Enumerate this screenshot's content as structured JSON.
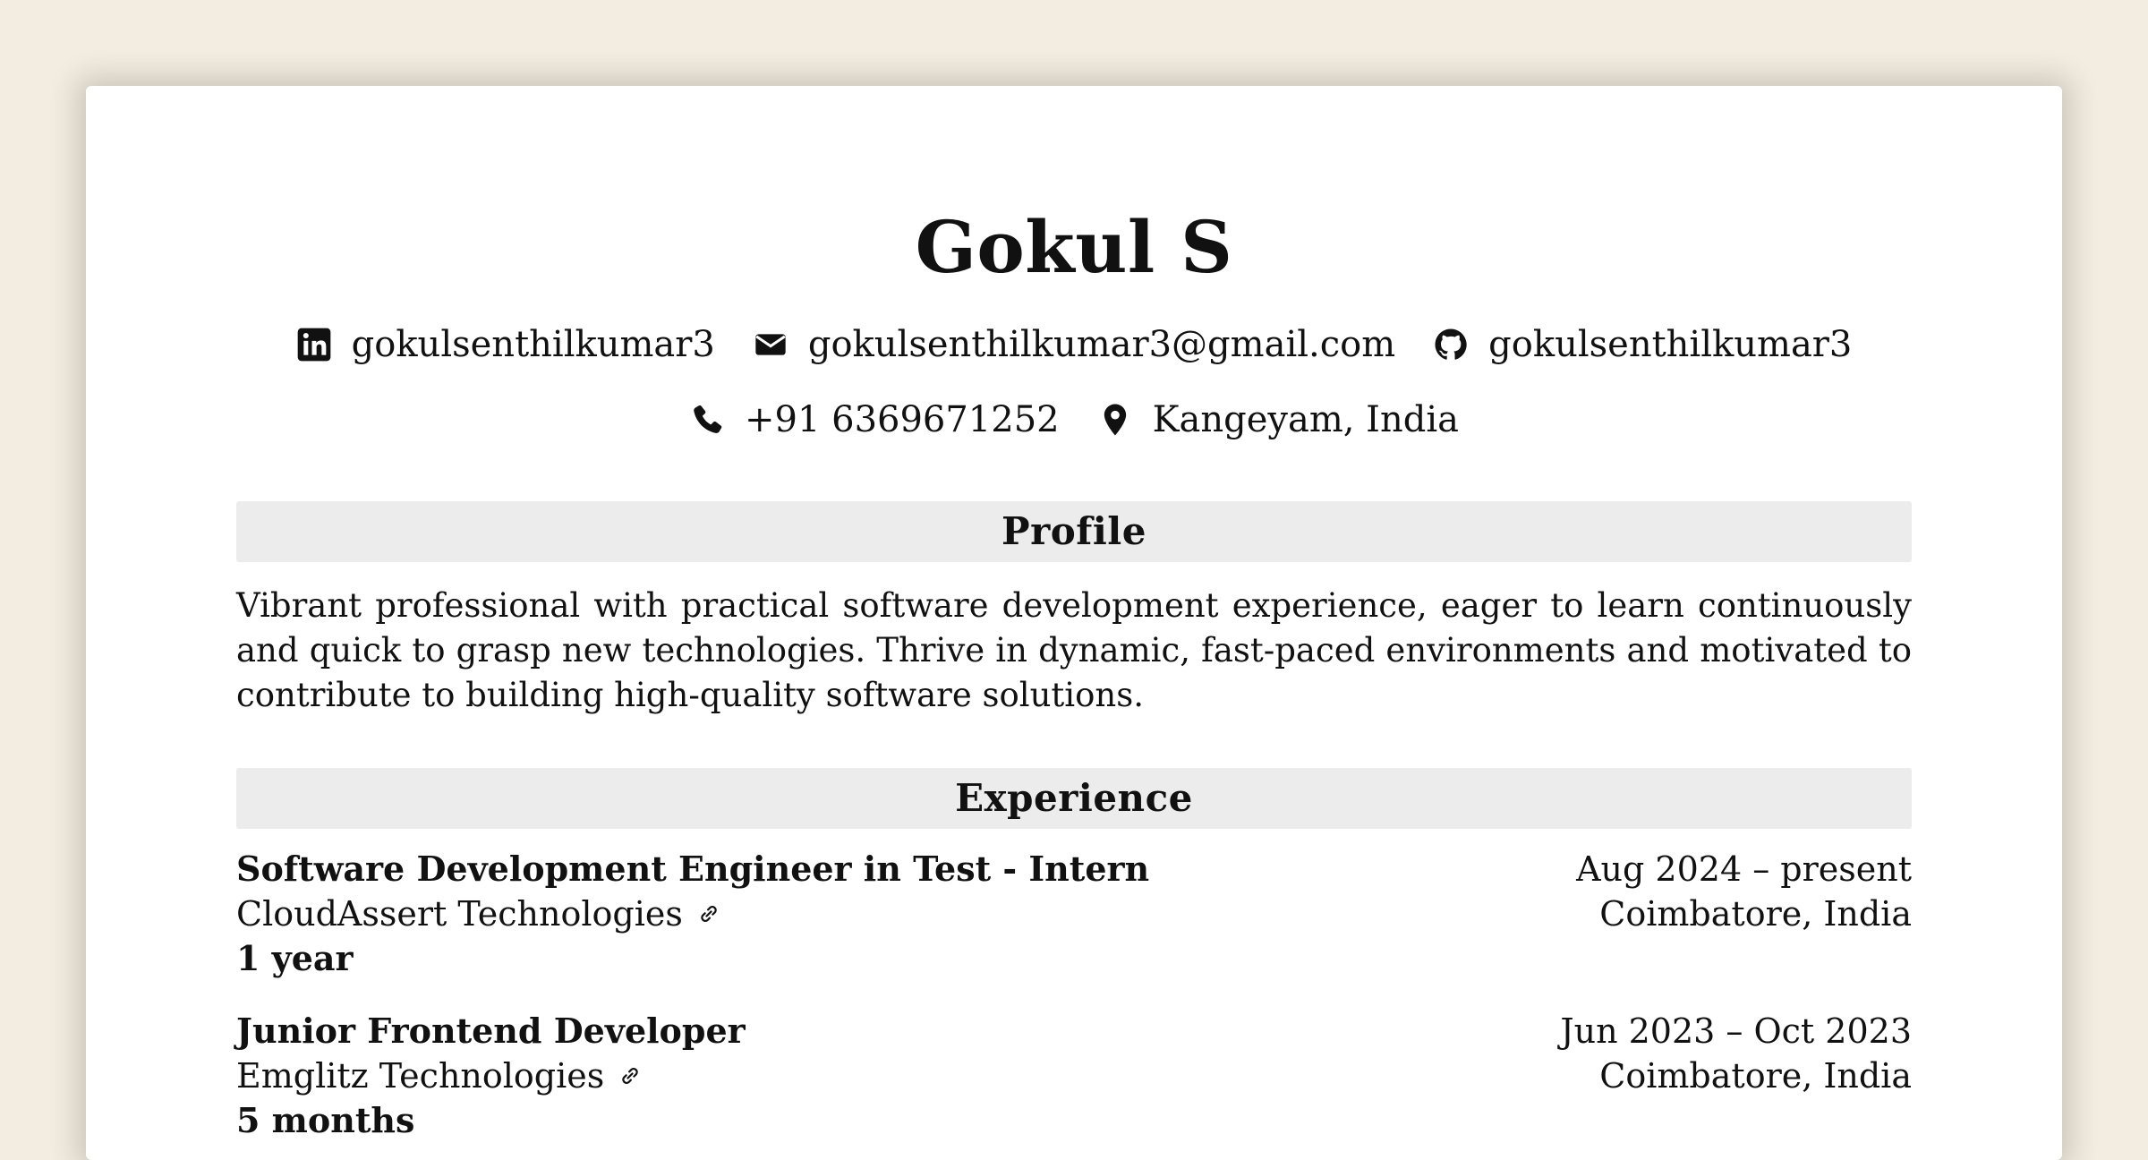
{
  "header": {
    "name": "Gokul S",
    "contacts_row1": [
      {
        "icon": "linkedin-icon",
        "text": "gokulsenthilkumar3"
      },
      {
        "icon": "mail-icon",
        "text": "gokulsenthilkumar3@gmail.com"
      },
      {
        "icon": "github-icon",
        "text": "gokulsenthilkumar3"
      }
    ],
    "contacts_row2": [
      {
        "icon": "phone-icon",
        "text": "+91 6369671252"
      },
      {
        "icon": "location-pin-icon",
        "text": "Kangeyam, India"
      }
    ]
  },
  "profile": {
    "heading": "Profile",
    "text": "Vibrant professional with practical software development experience, eager to learn continuously and quick to grasp new technologies. Thrive in dynamic, fast-paced environments and motivated to contribute to building high-quality software solutions."
  },
  "experience": {
    "heading": "Experience",
    "jobs": [
      {
        "title": "Software Development Engineer in Test - Intern",
        "dates": "Aug 2024 – present",
        "company": "CloudAssert Technologies",
        "location": "Coimbatore, India",
        "duration": "1 year",
        "link_icon": "link-icon"
      },
      {
        "title": "Junior Frontend Developer",
        "dates": "Jun 2023 – Oct 2023",
        "company": "Emglitz Technologies",
        "location": "Coimbatore, India",
        "duration": "5 months",
        "link_icon": "link-icon"
      }
    ]
  }
}
